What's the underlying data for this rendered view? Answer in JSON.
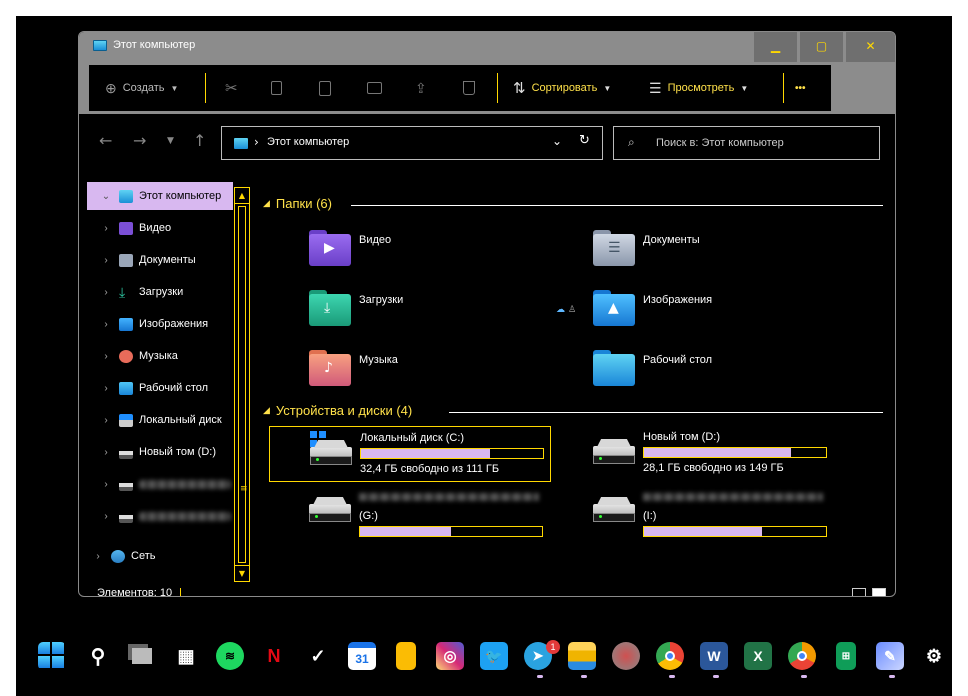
{
  "window": {
    "title": "Этот компьютер",
    "controls": {
      "minimize": "▁",
      "maximize": "▢",
      "close": "✕"
    }
  },
  "toolbar": {
    "create_label": "Создать",
    "sort_label": "Сортировать",
    "view_label": "Просмотреть",
    "more_label": "•••"
  },
  "address_bar": {
    "path": "Этот компьютер",
    "search_placeholder": "Поиск в: Этот компьютер"
  },
  "sidebar": {
    "items": [
      {
        "label": "Этот компьютер",
        "icon": "computer-icon",
        "selected": true
      },
      {
        "label": "Видео",
        "icon": "video-icon"
      },
      {
        "label": "Документы",
        "icon": "documents-icon"
      },
      {
        "label": "Загрузки",
        "icon": "downloads-icon"
      },
      {
        "label": "Изображения",
        "icon": "pictures-icon"
      },
      {
        "label": "Музыка",
        "icon": "music-icon"
      },
      {
        "label": "Рабочий стол",
        "icon": "desktop-icon"
      },
      {
        "label": "Локальный диск",
        "icon": "local-disk-icon"
      },
      {
        "label": "Новый том (D:)",
        "icon": "drive-icon"
      },
      {
        "label": "",
        "icon": "drive-icon",
        "blurred": true
      },
      {
        "label": "",
        "icon": "drive-icon",
        "blurred": true
      },
      {
        "label": "Сеть",
        "icon": "network-icon"
      }
    ]
  },
  "main": {
    "folders_header": "Папки (6)",
    "folders": [
      {
        "name": "Видео",
        "icon": "video-folder-icon"
      },
      {
        "name": "Документы",
        "icon": "documents-folder-icon"
      },
      {
        "name": "Загрузки",
        "icon": "downloads-folder-icon"
      },
      {
        "name": "Изображения",
        "icon": "pictures-folder-icon"
      },
      {
        "name": "Музыка",
        "icon": "music-folder-icon"
      },
      {
        "name": "Рабочий стол",
        "icon": "desktop-folder-icon"
      }
    ],
    "devices_header": "Устройства и диски (4)",
    "drives": [
      {
        "name": "Локальный диск (C:)",
        "free": "32,4 ГБ свободно из 111 ГБ",
        "used_fraction": 0.71
      },
      {
        "name": "Новый том (D:)",
        "free": "28,1 ГБ свободно из 149 ГБ",
        "used_fraction": 0.81
      },
      {
        "name": "(G:)",
        "free": "",
        "used_fraction": 0.5
      },
      {
        "name": "(I:)",
        "free": "",
        "used_fraction": 0.65
      }
    ]
  },
  "status_bar": {
    "items_count": "Элементов: 10"
  },
  "colors": {
    "accent": "#ffd800",
    "selection": "#d8b8f0",
    "header_text": "#ffe14a"
  },
  "taskbar": {
    "apps": [
      "start-icon",
      "search-icon",
      "task-view-icon",
      "calculator-icon",
      "spotify-icon",
      "netflix-icon",
      "todo-icon",
      "calendar-icon",
      "keep-icon",
      "instagram-icon",
      "twitter-icon",
      "telegram-icon",
      "explorer-icon",
      "record-icon",
      "chrome-icon",
      "word-icon",
      "excel-icon",
      "chrome-canary-icon",
      "sheets-icon",
      "paint-icon",
      "settings-icon"
    ],
    "calendar_day": "31",
    "netflix_letter": "N",
    "telegram_badge": "1",
    "word_letter": "W",
    "excel_letter": "X"
  }
}
